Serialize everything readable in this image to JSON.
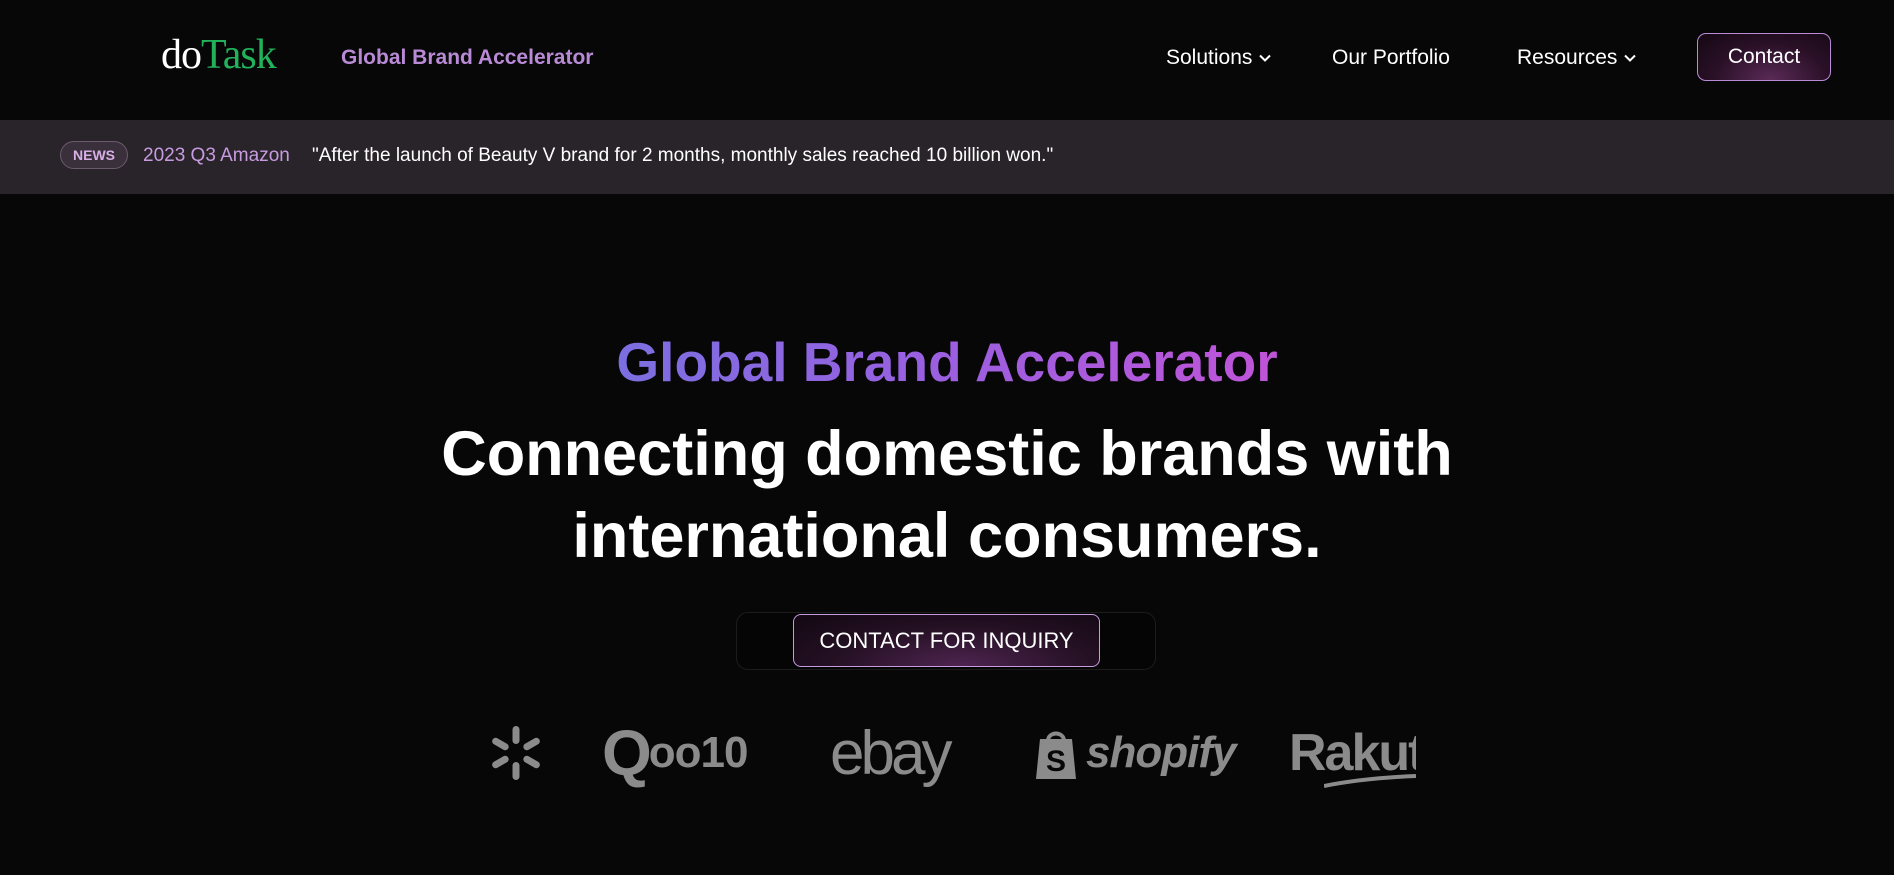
{
  "header": {
    "logo_do": "do",
    "logo_task": "Task",
    "tagline": "Global Brand Accelerator",
    "nav": [
      {
        "label": "Solutions",
        "has_dropdown": true
      },
      {
        "label": "Our Portfolio",
        "has_dropdown": false
      },
      {
        "label": "Resources",
        "has_dropdown": true
      }
    ],
    "contact_label": "Contact"
  },
  "news": {
    "badge": "NEWS",
    "source": "2023 Q3 Amazon",
    "quote": "\"After the launch of Beauty V brand for 2 months, monthly sales reached 10 billion won.\""
  },
  "hero": {
    "subtitle": "Global Brand Accelerator",
    "title_line1": "Connecting domestic brands with",
    "title_line2": "international consumers.",
    "cta_label": "CONTACT FOR INQUIRY"
  },
  "partners": {
    "qoo10_a": "Q",
    "qoo10_b": "oo10",
    "ebay": "ebay",
    "shopify": "shopify",
    "rakuten": "Rakut"
  },
  "colors": {
    "background": "#070707",
    "news_bar": "#29232a",
    "accent_purple": "#b98ad6",
    "logo_green": "#22b25a",
    "partner_logo_gray": "#8b8b8b"
  },
  "icons": [
    "chevron-down-icon",
    "walmart-spark-icon",
    "shopify-bag-icon"
  ]
}
